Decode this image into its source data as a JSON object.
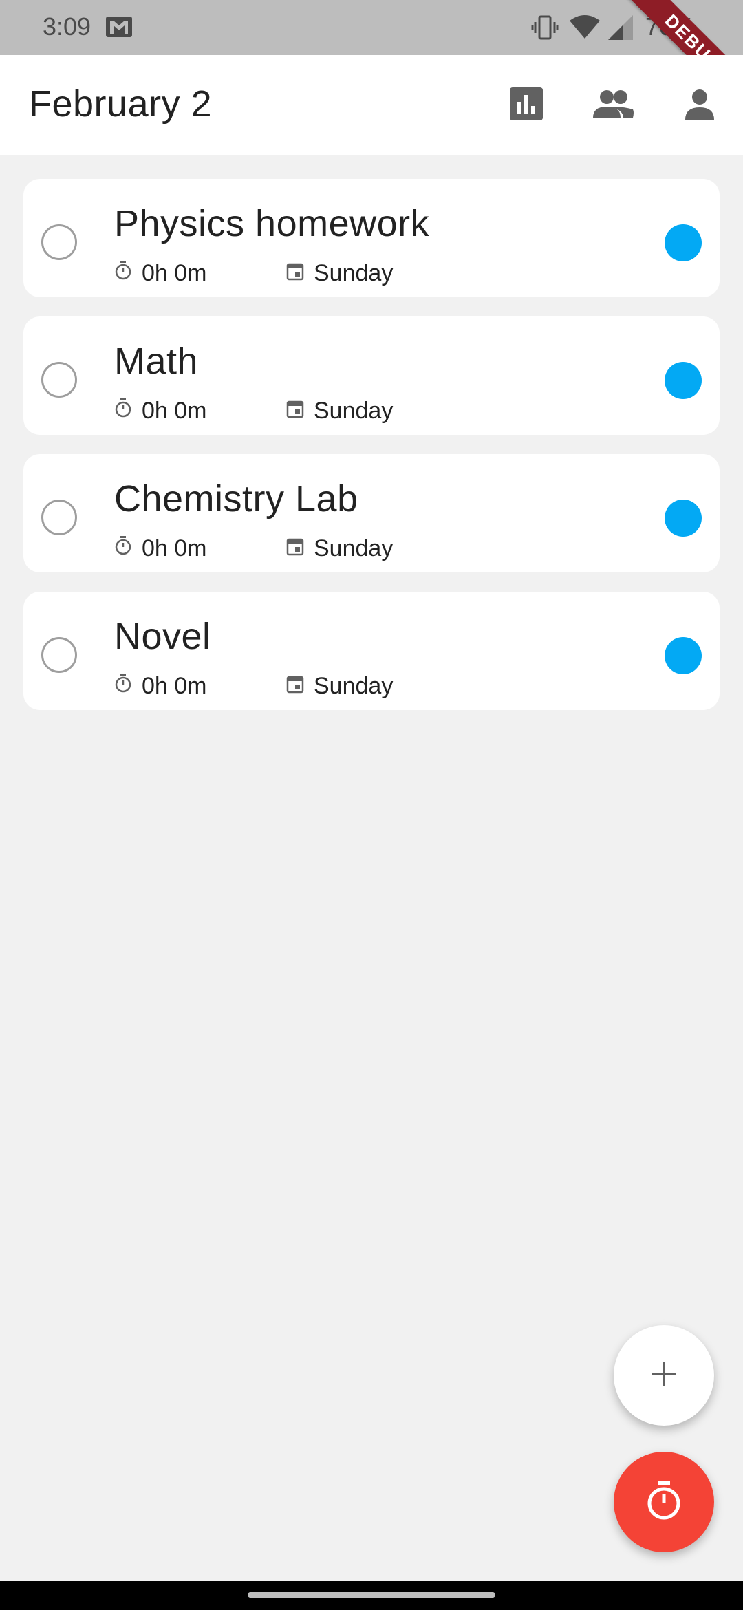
{
  "status_bar": {
    "time": "3:09",
    "battery": "70%",
    "icons": [
      "gmail-icon",
      "vibrate-icon",
      "wifi-icon",
      "signal-icon"
    ]
  },
  "debug_banner": "DEBUG",
  "header": {
    "title": "February 2",
    "actions": [
      {
        "name": "stats",
        "icon": "bar-chart-icon"
      },
      {
        "name": "friends",
        "icon": "people-icon"
      },
      {
        "name": "profile",
        "icon": "person-icon"
      }
    ]
  },
  "tasks": [
    {
      "title": "Physics homework",
      "time": "0h 0m",
      "day": "Sunday",
      "color": "#03a9f4"
    },
    {
      "title": "Math",
      "time": "0h 0m",
      "day": "Sunday",
      "color": "#03a9f4"
    },
    {
      "title": "Chemistry Lab",
      "time": "0h 0m",
      "day": "Sunday",
      "color": "#03a9f4"
    },
    {
      "title": "Novel",
      "time": "0h 0m",
      "day": "Sunday",
      "color": "#03a9f4"
    }
  ],
  "fabs": {
    "add_icon": "plus-icon",
    "timer_icon": "stopwatch-icon"
  },
  "colors": {
    "accent": "#03a9f4",
    "fab_timer": "#f44336",
    "background": "#f1f1f1"
  }
}
